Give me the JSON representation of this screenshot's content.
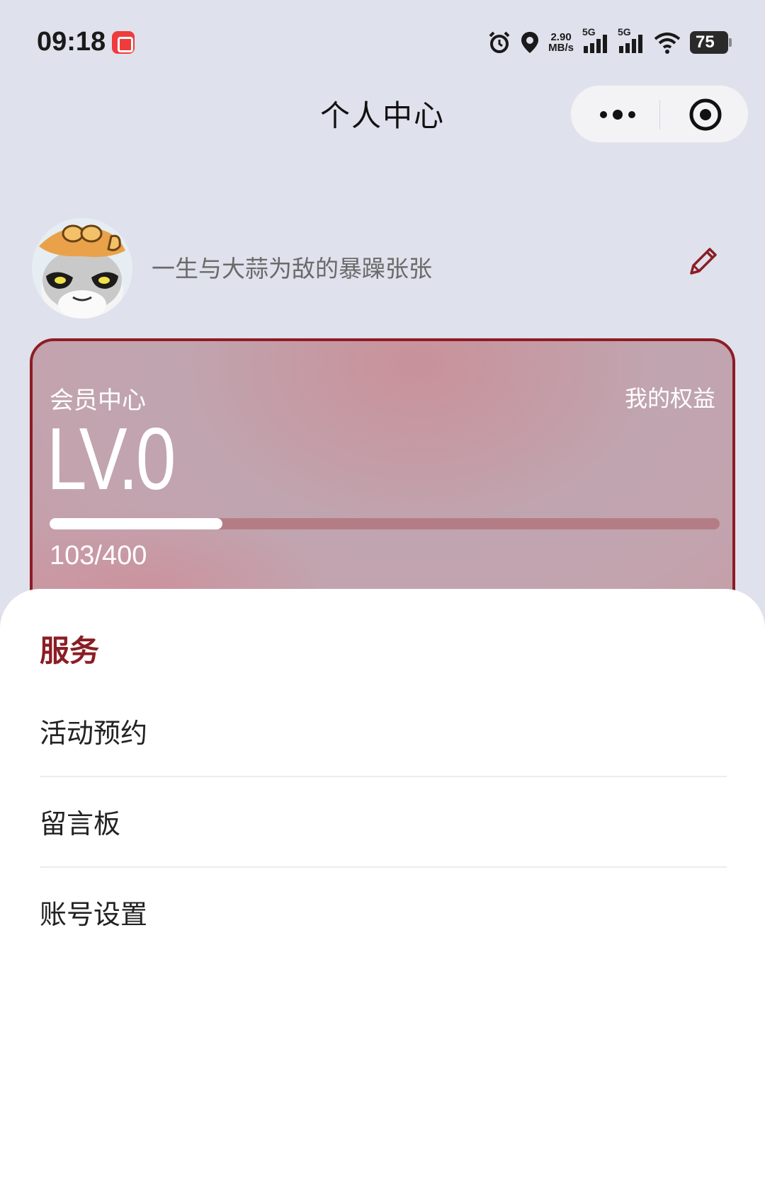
{
  "status_bar": {
    "time": "09:18",
    "net_speed_value": "2.90",
    "net_speed_unit": "MB/s",
    "signal_1_label": "5G",
    "signal_2_label": "5G",
    "battery": "75",
    "icons": [
      "alarm-icon",
      "location-icon",
      "signal-icon",
      "signal-icon",
      "wifi-icon",
      "battery-icon"
    ]
  },
  "header": {
    "title": "个人中心",
    "capsule_icons": [
      "more-icon",
      "target-icon"
    ]
  },
  "profile": {
    "nickname": "一生与大蒜为敌的暴躁张张",
    "edit_icon": "pencil-icon"
  },
  "member_card": {
    "title": "会员中心",
    "rights_link": "我的权益",
    "level": "LV.0",
    "progress_text": "103/400",
    "progress_current": 103,
    "progress_max": 400,
    "border_color": "#8e1c24"
  },
  "services": {
    "title": "服务",
    "items": [
      {
        "label": "活动预约"
      },
      {
        "label": "留言板"
      },
      {
        "label": "账号设置"
      }
    ],
    "accent_color": "#8b1d24"
  }
}
